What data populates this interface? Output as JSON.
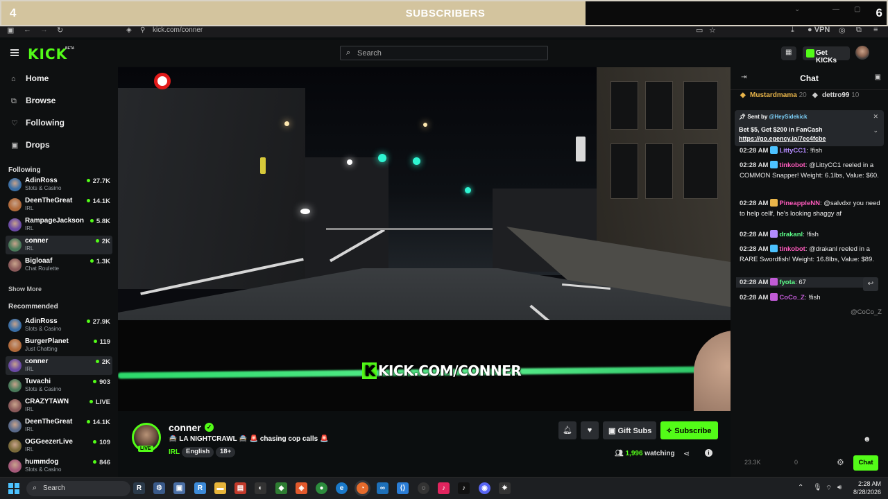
{
  "subscriber_goal": {
    "current": "4",
    "goal": "6",
    "label": "SUBSCRIBERS",
    "progress_fraction": 0.66
  },
  "browser": {
    "url": "kick.com/conner",
    "vpn_label": "VPN"
  },
  "header": {
    "logo": "KICK",
    "logo_badge": "BETA",
    "search_placeholder": "Search",
    "get_kicks_label": "Get KICKs"
  },
  "sidebar": {
    "nav": [
      {
        "label": "Home",
        "icon": "home-icon"
      },
      {
        "label": "Browse",
        "icon": "browse-icon"
      },
      {
        "label": "Following",
        "icon": "heart-icon"
      },
      {
        "label": "Drops",
        "icon": "gift-icon"
      }
    ],
    "following_heading": "Following",
    "following": [
      {
        "name": "AdinRoss",
        "category": "Slots & Casino",
        "viewers": "27.7K"
      },
      {
        "name": "DeenTheGreat",
        "category": "IRL",
        "viewers": "14.1K"
      },
      {
        "name": "RampageJackson",
        "category": "IRL",
        "viewers": "5.8K"
      },
      {
        "name": "conner",
        "category": "IRL",
        "viewers": "2K"
      },
      {
        "name": "Bigloaaf",
        "category": "Chat Roulette",
        "viewers": "1.3K"
      }
    ],
    "show_more": "Show More",
    "recommended_heading": "Recommended",
    "recommended": [
      {
        "name": "AdinRoss",
        "category": "Slots & Casino",
        "viewers": "27.9K"
      },
      {
        "name": "BurgerPlanet",
        "category": "Just Chatting",
        "viewers": "119"
      },
      {
        "name": "conner",
        "category": "IRL",
        "viewers": "2K"
      },
      {
        "name": "Tuvachi",
        "category": "Slots & Casino",
        "viewers": "903"
      },
      {
        "name": "CRAZYTAWN",
        "category": "IRL",
        "viewers": "LIVE"
      },
      {
        "name": "DeenTheGreat",
        "category": "IRL",
        "viewers": "14.1K"
      },
      {
        "name": "OGGeezerLive",
        "category": "IRL",
        "viewers": "109"
      },
      {
        "name": "hummdog",
        "category": "Slots & Casino",
        "viewers": "846"
      }
    ]
  },
  "video": {
    "overlay_text": "KICK.COM/CONNER",
    "overlay_badge": "K"
  },
  "stream": {
    "streamer": "conner",
    "live_badge": "LIVE",
    "title_a": "🚔 LA NIGHTCRAWL 🚔",
    "title_b": "chasing cop calls",
    "category": "IRL",
    "tags": [
      "English",
      "18+"
    ],
    "gift_label": "Gift Subs",
    "subscribe_label": "Subscribe",
    "viewers": "1,996",
    "viewers_suffix": "watching"
  },
  "chat": {
    "title": "Chat",
    "pinned": [
      {
        "user": "Mustardmama",
        "count": "20"
      },
      {
        "user": "dettro99",
        "count": "10"
      }
    ],
    "sidekick": {
      "sent_by": "Sent by",
      "handle": "@HeySidekick",
      "text": "Bet $5, Get $200 in FanCash",
      "link": "https://go.egency.io/7ec4fcbe"
    },
    "messages": [
      {
        "time": "02:28 AM",
        "user": "LittyCC1",
        "user_color": "#b48cff",
        "text": "!fish"
      },
      {
        "time": "02:28 AM",
        "user": "tinkobot",
        "user_color": "#ff5bbd",
        "text": "@LittyCC1 reeled in a COMMON Snapper! Weight: 6.1lbs, Value: $60."
      },
      {
        "time": "02:28 AM",
        "user": "PineappleNN",
        "user_color": "#ff5bbd",
        "text": "@salvdxr you need to help cellf, he's looking shaggy af"
      },
      {
        "time": "02:28 AM",
        "user": "drakanl",
        "user_color": "#5dff8a",
        "text": "!fish"
      },
      {
        "time": "02:28 AM",
        "user": "tinkobot",
        "user_color": "#ff5bbd",
        "text": "@drakanl reeled in a RARE Swordfish! Weight: 16.8lbs, Value: $89."
      },
      {
        "time": "02:28 AM",
        "user": "fyota",
        "user_color": "#5dff8a",
        "text": "67"
      },
      {
        "time": "02:28 AM",
        "user": "CoCo_Z",
        "user_color": "#c15bd6",
        "text": "!fish"
      },
      {
        "time": "",
        "user": "",
        "user_color": "#eee",
        "text": "@CoCo_Z"
      }
    ],
    "footer_stat_a": "23.3K",
    "footer_stat_b": "0",
    "send_label": "Chat"
  },
  "taskbar": {
    "search_label": "Search",
    "time": "2:28 AM",
    "date": "8/28/2026"
  },
  "colors": {
    "accent": "#53fc18",
    "background": "#0b0e0f"
  }
}
